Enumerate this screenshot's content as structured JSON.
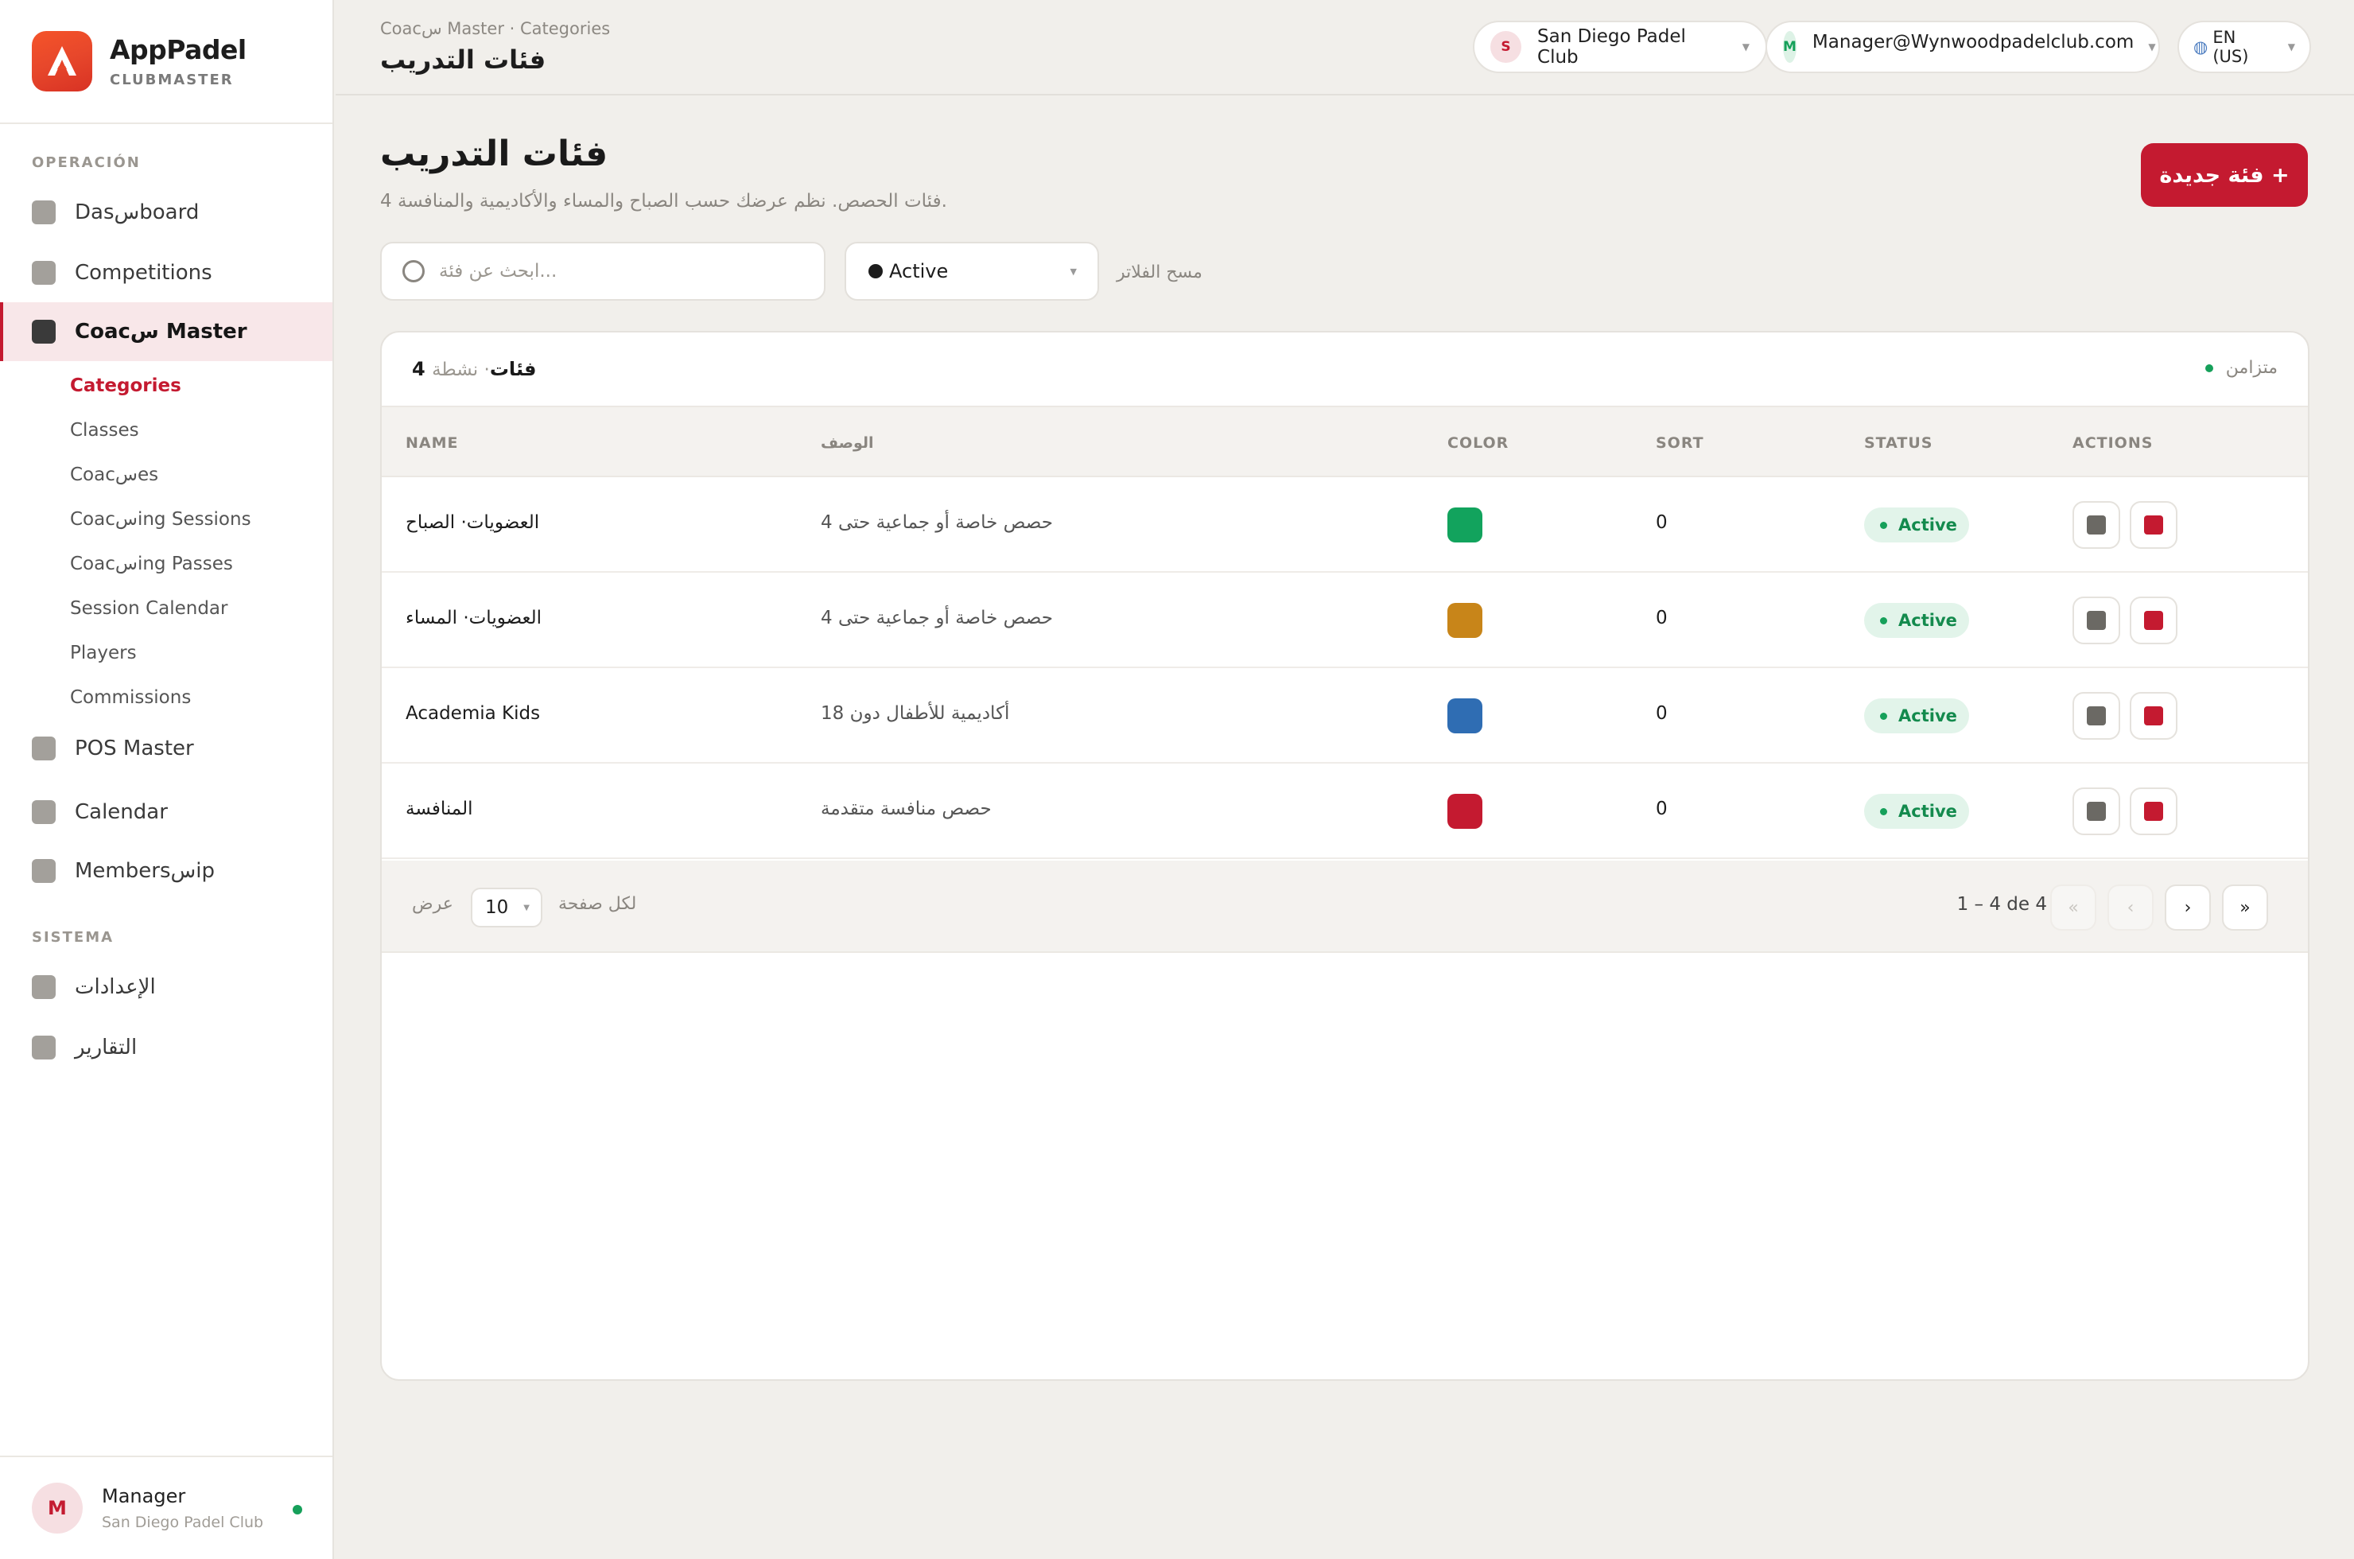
{
  "brand": {
    "name": "AppPadel",
    "subtitle": "CLUBMASTER"
  },
  "sidebar": {
    "sections": {
      "operation": "OPERACIÓN",
      "system": "SISTEMA"
    },
    "items": [
      {
        "label": "Dasسboard"
      },
      {
        "label": "Competitions"
      },
      {
        "label": "Coacس Master"
      },
      {
        "label": "POS Master"
      },
      {
        "label": "Calendar"
      },
      {
        "label": "Membersسip"
      },
      {
        "label": "الإعدادات"
      },
      {
        "label": "التقارير"
      }
    ],
    "subitems": [
      {
        "label": "Categories"
      },
      {
        "label": "Classes"
      },
      {
        "label": "Coacسes"
      },
      {
        "label": "Coacسing Sessions"
      },
      {
        "label": "Coacسing Passes"
      },
      {
        "label": "Session Calendar"
      },
      {
        "label": "Players"
      },
      {
        "label": "Commissions"
      }
    ]
  },
  "user": {
    "initial": "M",
    "name": "Manager",
    "club": "San Diego Padel Club"
  },
  "header": {
    "breadcrumb": "Coacس Master · Categories",
    "title": "فئات التدريب",
    "club": {
      "initial": "S",
      "label": "San Diego Padel Club"
    },
    "account": {
      "initial": "M",
      "label": "Manager@Wynwoodpadelclub.com"
    },
    "language": "EN (US)"
  },
  "page": {
    "title": "فئات التدريب",
    "subtitle": "4 فئات الحصص. نظم عرضك حسب الصباح والمساء والأكاديمية والمنافسة.",
    "new_button": "فئة جديدة  +"
  },
  "filters": {
    "search_placeholder": "ابحث عن فئة...",
    "status_value": "Active",
    "clear": "مسح الفلاتر"
  },
  "card": {
    "count_strong": "4 فئات",
    "count_rest": "· نشطة",
    "sync": "متزامن"
  },
  "table": {
    "headers": {
      "name": "NAME",
      "description": "الوصف",
      "color": "COLOR",
      "sort": "SORT",
      "status": "STATUS",
      "actions": "ACTIONS"
    },
    "rows": [
      {
        "name": "العضويات· الصباح",
        "description": "حصص خاصة أو جماعية حتى 4",
        "color": "#12a35d",
        "sort": "0",
        "status": "Active"
      },
      {
        "name": "العضويات· المساء",
        "description": "حصص خاصة أو جماعية حتى 4",
        "color": "#c88519",
        "sort": "0",
        "status": "Active"
      },
      {
        "name": "Academia Kids",
        "description": "أكاديمية للأطفال دون 18",
        "color": "#2f6db3",
        "sort": "0",
        "status": "Active"
      },
      {
        "name": "المنافسة",
        "description": "حصص منافسة متقدمة",
        "color": "#c41a30",
        "sort": "0",
        "status": "Active"
      }
    ]
  },
  "pagination": {
    "show_label": "عرض",
    "per_page": "10",
    "per_page_label": "لكل صفحة",
    "range": "1 – 4 de 4",
    "first": "«",
    "prev": "‹",
    "next": "›",
    "last": "»"
  },
  "colors": {
    "accent": "#c41a30",
    "success": "#16a05a",
    "edit": "#6b6964"
  }
}
